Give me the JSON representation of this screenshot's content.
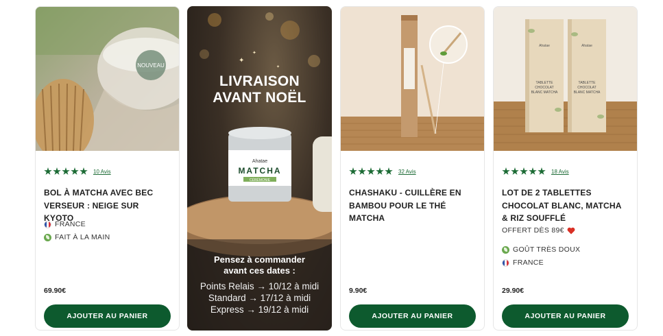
{
  "products": [
    {
      "badge": "NOUVEAU",
      "reviews": "10 Avis",
      "title": "BOL À MATCHA AVEC BEC VERSEUR : NEIGE SUR KYOTO",
      "attr1": "FRANCE",
      "attr2": "FAIT À LA MAIN",
      "price": "69.90€",
      "cta": "AJOUTER AU PANIER"
    },
    {
      "reviews": "32 Avis",
      "title": "CHASHAKU - CUILLÈRE EN BAMBOU POUR LE THÉ MATCHA",
      "price": "9.90€",
      "cta": "AJOUTER AU PANIER"
    },
    {
      "reviews": "18 Avis",
      "title": "LOT DE 2 TABLETTES CHOCOLAT BLANC, MATCHA & RIZ SOUFFLÉ",
      "offer": "OFFERT DÈS 89€",
      "attr1": "GOÛT TRÈS DOUX",
      "attr2": "FRANCE",
      "price": "29.90€",
      "cta": "AJOUTER AU PANIER",
      "box_brand": "Ahatae",
      "box_label": "TABLETTE CHOCOLAT BLANC MATCHA"
    }
  ],
  "promo": {
    "title_line1": "LIVRAISON",
    "title_line2": "AVANT NOËL",
    "tin_brand": "Ahatae",
    "tin_label": "MATCHA",
    "tin_sub": "CÉRÉMONIE",
    "sub_line1": "Pensez à commander",
    "sub_line2": "avant ces dates :",
    "date1": "Points Relais → 10/12 à midi",
    "date2": "Standard → 17/12 à midi",
    "date3": "Express → 19/12 à midi"
  },
  "colors": {
    "cta_bg": "#0d5a2e",
    "stars": "#1c6b35",
    "heart": "#d93025"
  }
}
